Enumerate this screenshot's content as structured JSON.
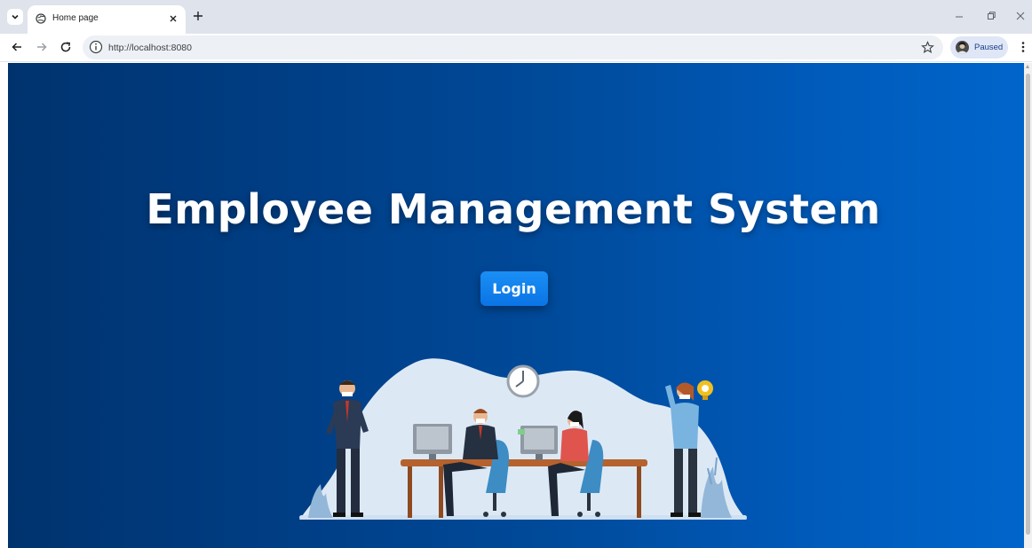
{
  "browser": {
    "tab": {
      "title": "Home page"
    },
    "address": {
      "url": "http://localhost:8080"
    },
    "profile": {
      "label": "Paused"
    }
  },
  "page": {
    "title": "Employee Management System",
    "login_label": "Login"
  },
  "icons": [
    "tab-search-icon",
    "globe-icon",
    "close-icon",
    "plus-icon",
    "minimize-icon",
    "restore-icon",
    "window-close-icon",
    "back-arrow-icon",
    "forward-arrow-icon",
    "reload-icon",
    "info-icon",
    "star-icon",
    "avatar",
    "more-vert-icon",
    "office-illustration"
  ],
  "colors": {
    "accent": "#0b74e5",
    "background_start": "#00336e",
    "background_end": "#0065cb"
  }
}
